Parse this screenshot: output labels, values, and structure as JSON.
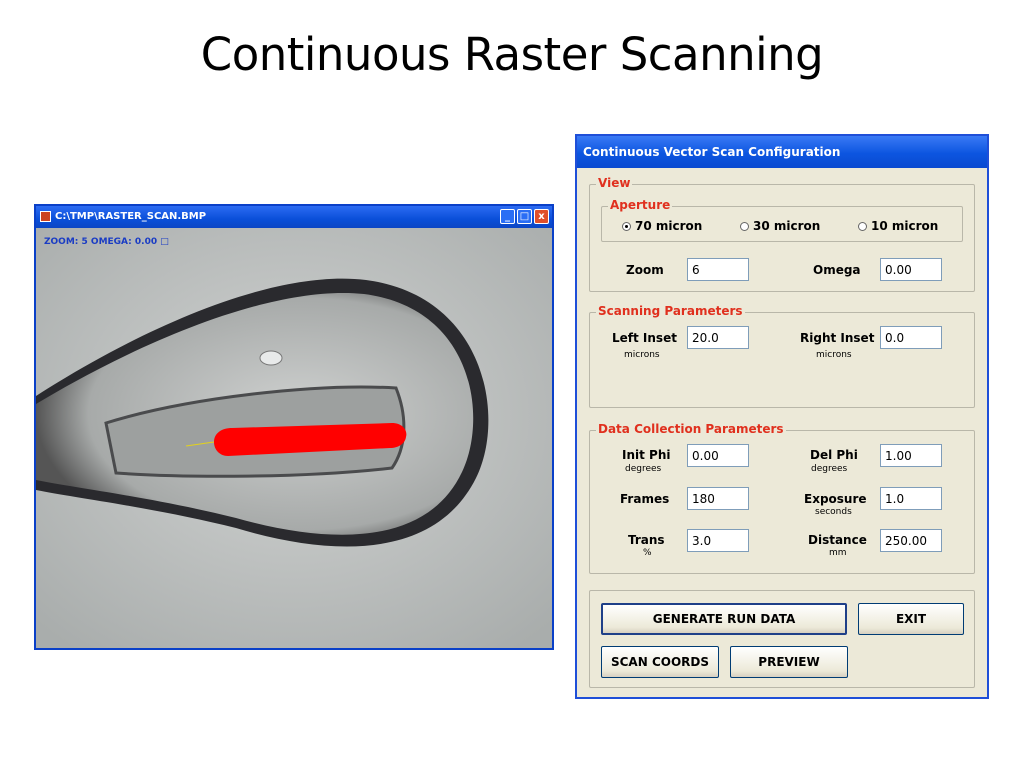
{
  "slide": {
    "title": "Continuous Raster Scanning"
  },
  "viewer": {
    "title": "C:\\TMP\\RASTER_SCAN.BMP",
    "status": "ZOOM: 5  OMEGA: 0.00 □",
    "min_btn": "_",
    "max_btn": "□",
    "close_btn": "x"
  },
  "dialog": {
    "title": "Continuous Vector Scan Configuration",
    "view": {
      "label": "View",
      "aperture": {
        "label": "Aperture",
        "options": [
          "70 micron",
          "30 micron",
          "10 micron"
        ],
        "selected": "70 micron"
      },
      "zoom_label": "Zoom",
      "zoom_value": "6",
      "omega_label": "Omega",
      "omega_value": "0.00"
    },
    "scanning": {
      "label": "Scanning Parameters",
      "left_inset_label": "Left Inset",
      "left_inset_unit": "microns",
      "left_inset_value": "20.0",
      "right_inset_label": "Right Inset",
      "right_inset_unit": "microns",
      "right_inset_value": "0.0"
    },
    "data_collection": {
      "label": "Data Collection Parameters",
      "init_phi_label": "Init Phi",
      "init_phi_unit": "degrees",
      "init_phi_value": "0.00",
      "del_phi_label": "Del Phi",
      "del_phi_unit": "degrees",
      "del_phi_value": "1.00",
      "frames_label": "Frames",
      "frames_value": "180",
      "exposure_label": "Exposure",
      "exposure_unit": "seconds",
      "exposure_value": "1.0",
      "trans_label": "Trans",
      "trans_unit": "%",
      "trans_value": "3.0",
      "distance_label": "Distance",
      "distance_unit": "mm",
      "distance_value": "250.00"
    },
    "buttons": {
      "generate": "GENERATE RUN DATA",
      "exit": "EXIT",
      "scan_coords": "SCAN COORDS",
      "preview": "PREVIEW"
    }
  },
  "colors": {
    "scan_path": "#ff0000",
    "group_label": "#e0301e",
    "titlebar": "#0c55e0"
  }
}
